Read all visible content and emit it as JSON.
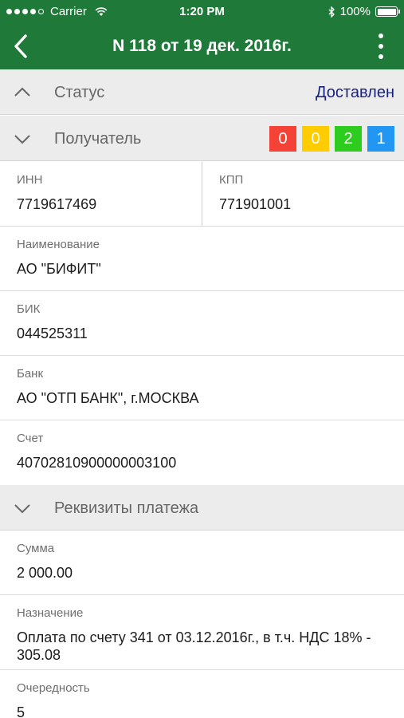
{
  "status_bar": {
    "carrier": "Carrier",
    "time": "1:20 PM",
    "battery": "100%"
  },
  "nav": {
    "title": "N 118 от 19 дек. 2016г."
  },
  "sections": {
    "status": {
      "title": "Статус",
      "value": "Доставлен"
    },
    "recipient": {
      "title": "Получатель",
      "counters": [
        {
          "value": "0",
          "color": "#f44336"
        },
        {
          "value": "0",
          "color": "#ffcc00"
        },
        {
          "value": "2",
          "color": "#2ecc1f"
        },
        {
          "value": "1",
          "color": "#2196f3"
        }
      ]
    },
    "payment": {
      "title": "Реквизиты платежа"
    }
  },
  "recipient_fields": {
    "inn": {
      "label": "ИНН",
      "value": "7719617469"
    },
    "kpp": {
      "label": "КПП",
      "value": "771901001"
    },
    "name": {
      "label": "Наименование",
      "value": "АО \"БИФИТ\""
    },
    "bik": {
      "label": "БИК",
      "value": "044525311"
    },
    "bank": {
      "label": "Банк",
      "value": "АО \"ОТП БАНК\", г.МОСКВА"
    },
    "account": {
      "label": "Счет",
      "value": "40702810900000003100"
    }
  },
  "payment_fields": {
    "amount": {
      "label": "Сумма",
      "value": "2 000.00"
    },
    "purpose": {
      "label": "Назначение",
      "value": "Оплата по счету 341 от 03.12.2016г., в т.ч. НДС 18% - 305.08"
    },
    "priority": {
      "label": "Очередность",
      "value": "5"
    }
  },
  "colors": {
    "header_green": "#1f7a3a",
    "status_text": "#1a237e"
  }
}
